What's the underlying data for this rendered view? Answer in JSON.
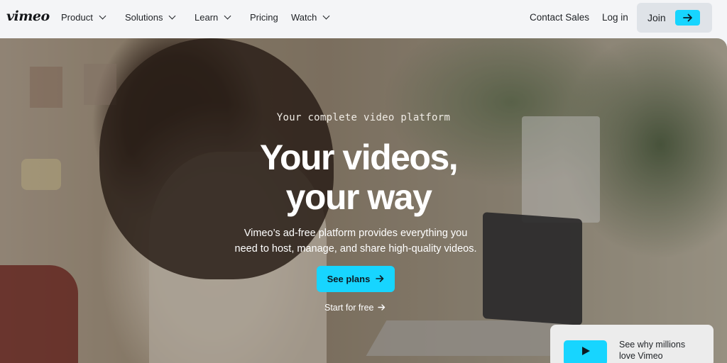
{
  "nav": {
    "logo": "vimeo",
    "items": [
      {
        "label": "Product",
        "has_dropdown": true
      },
      {
        "label": "Solutions",
        "has_dropdown": true
      },
      {
        "label": "Learn",
        "has_dropdown": true
      },
      {
        "label": "Pricing",
        "has_dropdown": false
      },
      {
        "label": "Watch",
        "has_dropdown": true
      }
    ],
    "contact_sales": "Contact Sales",
    "login": "Log in",
    "join": "Join"
  },
  "hero": {
    "tagline": "Your complete video platform",
    "headline_line1": "Your videos,",
    "headline_line2": "your way",
    "description_line1": "Vimeo’s ad-free platform provides everything you",
    "description_line2": "need to host, manage, and share high-quality videos.",
    "primary_cta": "See plans",
    "secondary_cta": "Start for free"
  },
  "promo_card": {
    "text_line1": "See why millions",
    "text_line2": "love Vimeo"
  },
  "colors": {
    "accent": "#17d5ff",
    "nav_bg": "#f4f5f7",
    "join_bg": "#dfe3e8"
  },
  "icons": {
    "dropdown": "chevron-down-icon",
    "arrow": "arrow-right-icon",
    "play": "play-icon"
  }
}
